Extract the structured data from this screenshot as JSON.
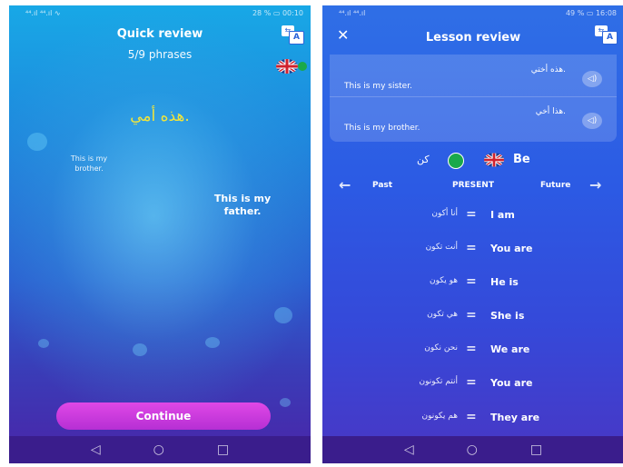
{
  "left_screen": {
    "status": {
      "signal": "⁴⁴.ıl ⁴⁴.ıl ∿",
      "battery": "28 % ▭ 00:10"
    },
    "title": "Quick review",
    "progress": "5/9 phrases",
    "translate_icon": {
      "small": "⇆",
      "large": "A"
    },
    "arabic_phrase": "هذه أمي.",
    "options": [
      {
        "text": "This is my brother."
      },
      {
        "text": "This is my father."
      }
    ],
    "continue_label": "Continue",
    "nav": {
      "back": "◁",
      "home": "○",
      "recent": "□"
    }
  },
  "right_screen": {
    "status": {
      "signal": "⁴⁴.ıl ⁴⁴.ıl",
      "battery": "49 % ▭ 16:08"
    },
    "close_icon": "✕",
    "title": "Lesson review",
    "translate_icon": {
      "small": "⇆",
      "large": "A"
    },
    "review_items": [
      {
        "arabic": "هذه أختي.",
        "english": "This is my sister.",
        "speaker_icon": "◁)"
      },
      {
        "arabic": "هذا أخي.",
        "english": "This is my brother.",
        "speaker_icon": "◁)"
      }
    ],
    "verb": {
      "arabic": "كن",
      "english": "Be"
    },
    "tenses": {
      "past": "Past",
      "present": "PRESENT",
      "future": "Future",
      "left_arrow": "←",
      "right_arrow": "→"
    },
    "equals": "=",
    "conjugations": [
      {
        "arabic": "أنا أكون",
        "english": "I am"
      },
      {
        "arabic": "أنت تكون",
        "english": "You are"
      },
      {
        "arabic": "هو يكون",
        "english": "He is"
      },
      {
        "arabic": "هي تكون",
        "english": "She is"
      },
      {
        "arabic": "نحن نكون",
        "english": "We are"
      },
      {
        "arabic": "أنتم تكونون",
        "english": "You are"
      },
      {
        "arabic": "هم يكونون",
        "english": "They are"
      }
    ],
    "nav": {
      "back": "◁",
      "home": "○",
      "recent": "□"
    }
  },
  "colors": {
    "accent_yellow": "#f2e53a",
    "continue_pink": "#d23fe0",
    "arabic_flag_green": "#1aa94a"
  }
}
